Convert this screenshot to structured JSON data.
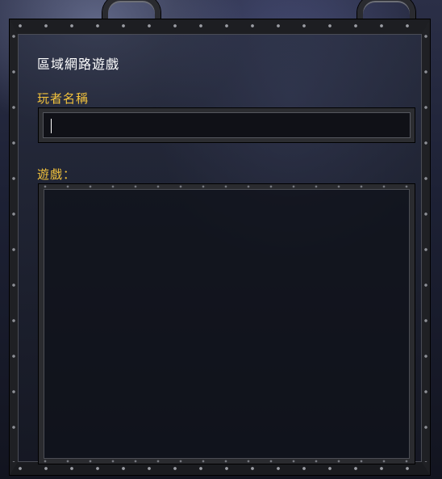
{
  "dialog": {
    "title": "區域網路遊戲",
    "player_name_label": "玩者名稱",
    "player_name_value": "",
    "games_label": "遊戲："
  },
  "games": [],
  "colors": {
    "title_text": "#ffffff",
    "label_text": "#f2c23c",
    "frame_metal": "#2a2b2f",
    "field_background": "#101117"
  }
}
